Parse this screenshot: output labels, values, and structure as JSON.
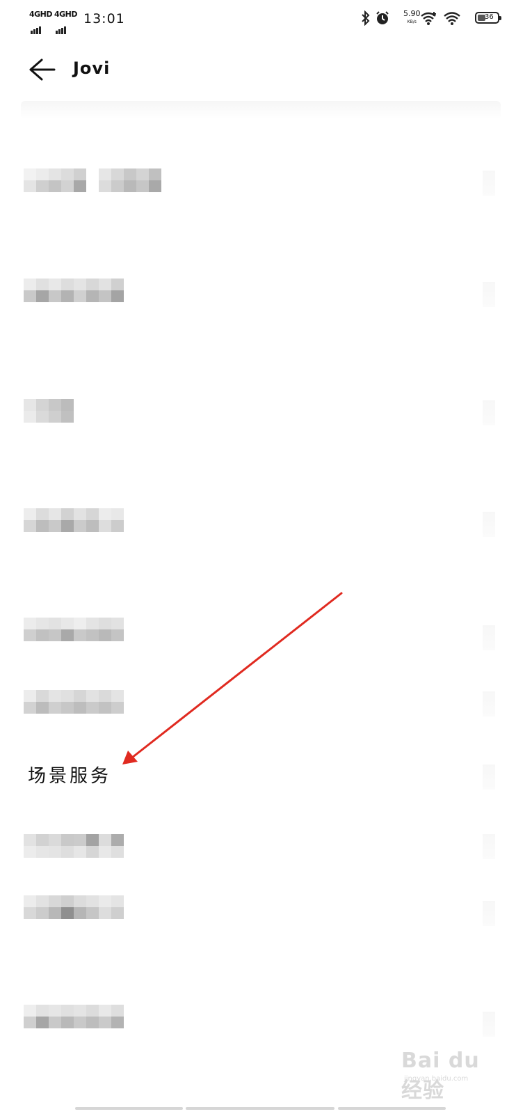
{
  "status_bar": {
    "sim1_network": "4GHD",
    "sim2_network": "4GHD",
    "time": "13:01",
    "net_speed": "5.90",
    "net_speed_unit": "KB/s",
    "battery_level": "36",
    "icons": [
      "bluetooth-icon",
      "alarm-icon",
      "wifi-plus-icon",
      "wifi-icon",
      "battery-icon"
    ]
  },
  "header": {
    "title": "Jovi",
    "back_icon": "back-arrow-icon"
  },
  "list": {
    "highlighted_item_label": "场景服务",
    "items": [
      {
        "label": "",
        "blurred": true
      },
      {
        "label": "",
        "blurred": true
      },
      {
        "label": "",
        "blurred": true
      },
      {
        "label": "",
        "blurred": true
      },
      {
        "label": "",
        "blurred": true
      },
      {
        "label": "",
        "blurred": true
      },
      {
        "label": "场景服务",
        "blurred": false
      },
      {
        "label": "",
        "blurred": true
      },
      {
        "label": "",
        "blurred": true
      },
      {
        "label": "",
        "blurred": true
      }
    ]
  },
  "annotation": {
    "arrow_color": "#e02a20",
    "arrow_icon": "red-arrow-annotation"
  },
  "watermark": {
    "brand": "Bai du 经验",
    "url": "jingyan.baidu.com"
  },
  "colors": {
    "background": "#ffffff",
    "text": "#111111"
  }
}
